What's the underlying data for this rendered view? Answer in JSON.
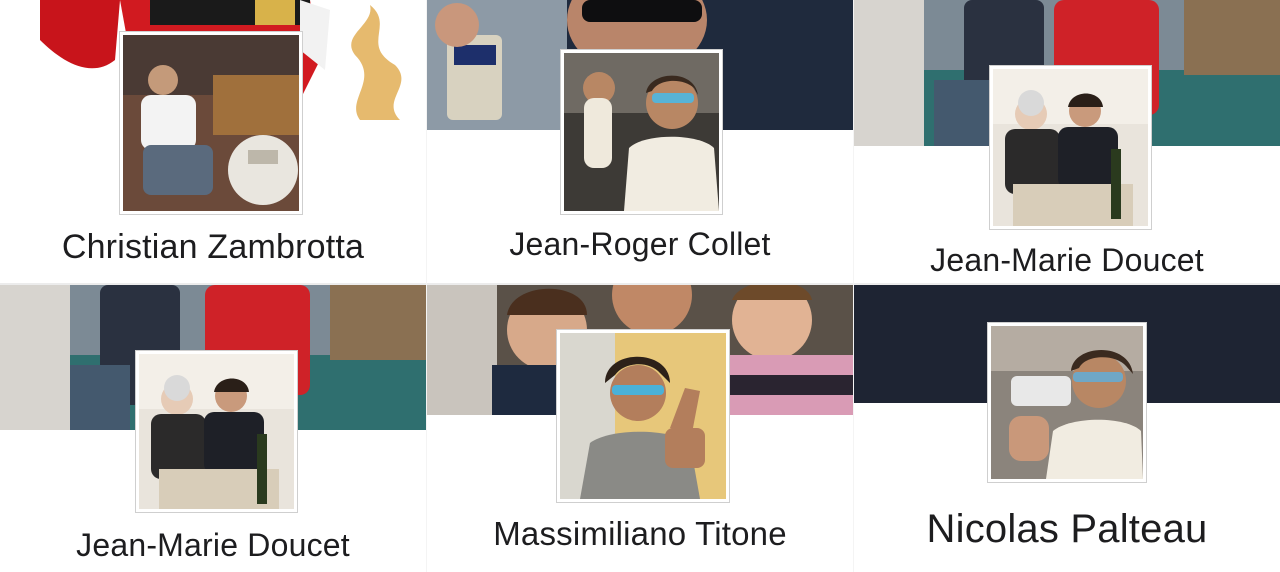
{
  "profiles": [
    {
      "name": "Christian Zambrotta",
      "cover": "santa-cover",
      "avatar": "man-on-sofa-photo"
    },
    {
      "name": "Jean-Roger Collet",
      "cover": "selfie-with-beer-cover",
      "avatar": "man-in-car-sunglasses-photo"
    },
    {
      "name": "Jean-Marie Doucet",
      "cover": "harbor-boat-cover",
      "avatar": "dinner-with-elderly-woman-photo"
    },
    {
      "name": "Jean-Marie Doucet",
      "cover": "harbor-boat-cover",
      "avatar": "dinner-with-elderly-woman-photo"
    },
    {
      "name": "Massimiliano Titone",
      "cover": "selfie-with-kids-cover",
      "avatar": "thumbs-up-sunglasses-photo"
    },
    {
      "name": "Nicolas Palteau",
      "cover": "dark-navy-cover",
      "avatar": "man-in-car-sunglasses-photo"
    }
  ],
  "colors": {
    "navy_cover": "#1e2433",
    "name_text": "#1d1d1f"
  }
}
